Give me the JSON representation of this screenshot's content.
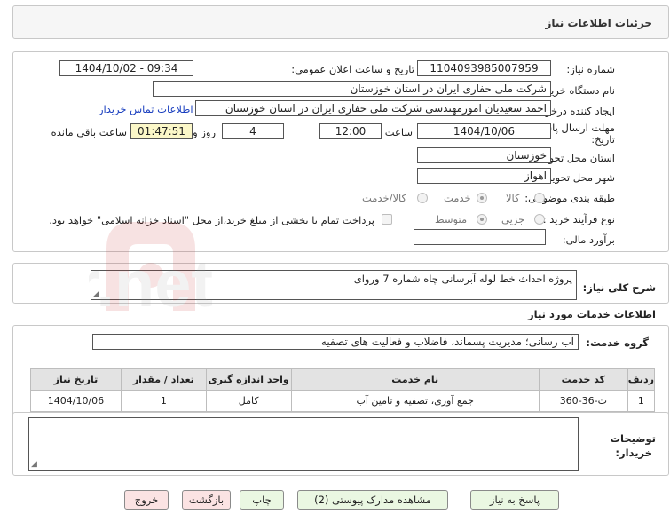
{
  "header": {
    "title": "جزئیات اطلاعات نیاز"
  },
  "form": {
    "need_number_label": "شماره نیاز:",
    "need_number": "1104093985007959",
    "announce_label": "تاریخ و ساعت اعلان عمومی:",
    "announce_value": "1404/10/02 - 09:34",
    "buyer_label": "نام دستگاه خریدار:",
    "buyer_value": "شرکت ملی حفاری ایران در استان خوزستان",
    "creator_label": "ایجاد کننده درخواست:",
    "creator_value": "احمد سعیدیان امورمهندسی شرکت ملی حفاری ایران در استان خوزستان",
    "contact_link": "اطلاعات تماس خریدار",
    "deadline_label_1": "مهلت ارسال پاسخ: تا",
    "deadline_label_2": "تاریخ:",
    "deadline_date": "1404/10/06",
    "time_label": "ساعت",
    "deadline_time": "12:00",
    "days_value": "4",
    "days_label": "روز و",
    "remaining_time": "01:47:51",
    "remaining_label": "ساعت باقی مانده",
    "province_label": "استان محل تحویل:",
    "province_value": "خوزستان",
    "city_label": "شهر محل تحویل:",
    "city_value": "اهواز",
    "category_label": "طبقه بندی موضوعی:",
    "category_options": [
      "کالا",
      "خدمت",
      "کالا/خدمت"
    ],
    "category_selected": "خدمت",
    "process_label": "نوع فرآیند خرید :",
    "process_options": [
      "جزیی",
      "متوسط"
    ],
    "process_selected": "متوسط",
    "payment_note": "پرداخت تمام یا بخشی از مبلغ خرید،از محل \"اسناد خزانه اسلامی\" خواهد بود.",
    "budget_label": "برآورد مالی:",
    "budget_value": ""
  },
  "description": {
    "label": "شرح کلی نیاز:",
    "value": "پروژه احداث خط لوله آبرسانی چاه شماره 7 وروای"
  },
  "services": {
    "section_title": "اطلاعات خدمات مورد نیاز",
    "group_label": "گروه خدمت:",
    "group_value": "آب رسانی؛ مدیریت پسماند، فاضلاب و فعالیت های تصفیه",
    "columns": [
      "ردیف",
      "کد خدمت",
      "نام خدمت",
      "واحد اندازه گیری",
      "تعداد / مقدار",
      "تاریخ نیاز"
    ],
    "rows": [
      [
        "1",
        "ث-36-360",
        "جمع آوری، تصفیه و تامین آب",
        "کامل",
        "1",
        "1404/10/06"
      ]
    ]
  },
  "buyer_notes": {
    "label_1": "توضیحات",
    "label_2": "خریدار:",
    "value": ""
  },
  "buttons": {
    "reply": "پاسخ به نیاز",
    "view_docs": "مشاهده مدارک پیوستی (2)",
    "print": "چاپ",
    "back": "بازگشت",
    "exit": "خروج"
  },
  "watermark": {
    "text": "AriaTender.net"
  },
  "colors": {
    "link": "#1a3fbf",
    "remaining_bg": "#fbf7c8",
    "green_btn": "#eaf7e2",
    "red_btn": "#fbe3e3"
  }
}
